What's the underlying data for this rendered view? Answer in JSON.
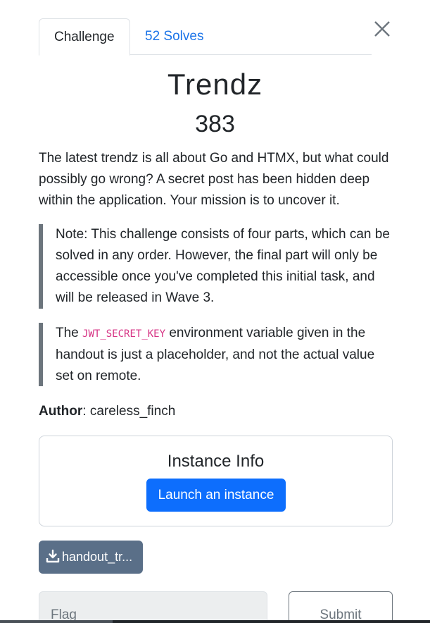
{
  "tabs": [
    {
      "label": "Challenge"
    },
    {
      "label": "52 Solves"
    }
  ],
  "challenge": {
    "name": "Trendz",
    "points": "383",
    "description": "The latest trendz is all about Go and HTMX, but what could possibly go wrong? A secret post has been hidden deep within the application. Your mission is to uncover it.",
    "note1": "Note: This challenge consists of four parts, which can be solved in any order. However, the final part will only be accessible once you've completed this initial task, and will be released in Wave 3.",
    "note2_before": "The ",
    "note2_code": "JWT_SECRET_KEY",
    "note2_after": " environment variable given in the handout is just a placeholder, and not the actual value set on remote.",
    "author_label": "Author",
    "author_value": ": careless_finch"
  },
  "instance": {
    "title": "Instance Info",
    "launch_label": "Launch an instance"
  },
  "download": {
    "label": "handout_tr..."
  },
  "flag": {
    "placeholder": "Flag",
    "submit_label": "Submit"
  },
  "icons": {
    "close": "close-icon",
    "download": "download-icon"
  },
  "colors": {
    "link": "#1a73e8",
    "primary": "#0d6efd",
    "code": "#d63384",
    "download_bg": "#5a6f88"
  }
}
